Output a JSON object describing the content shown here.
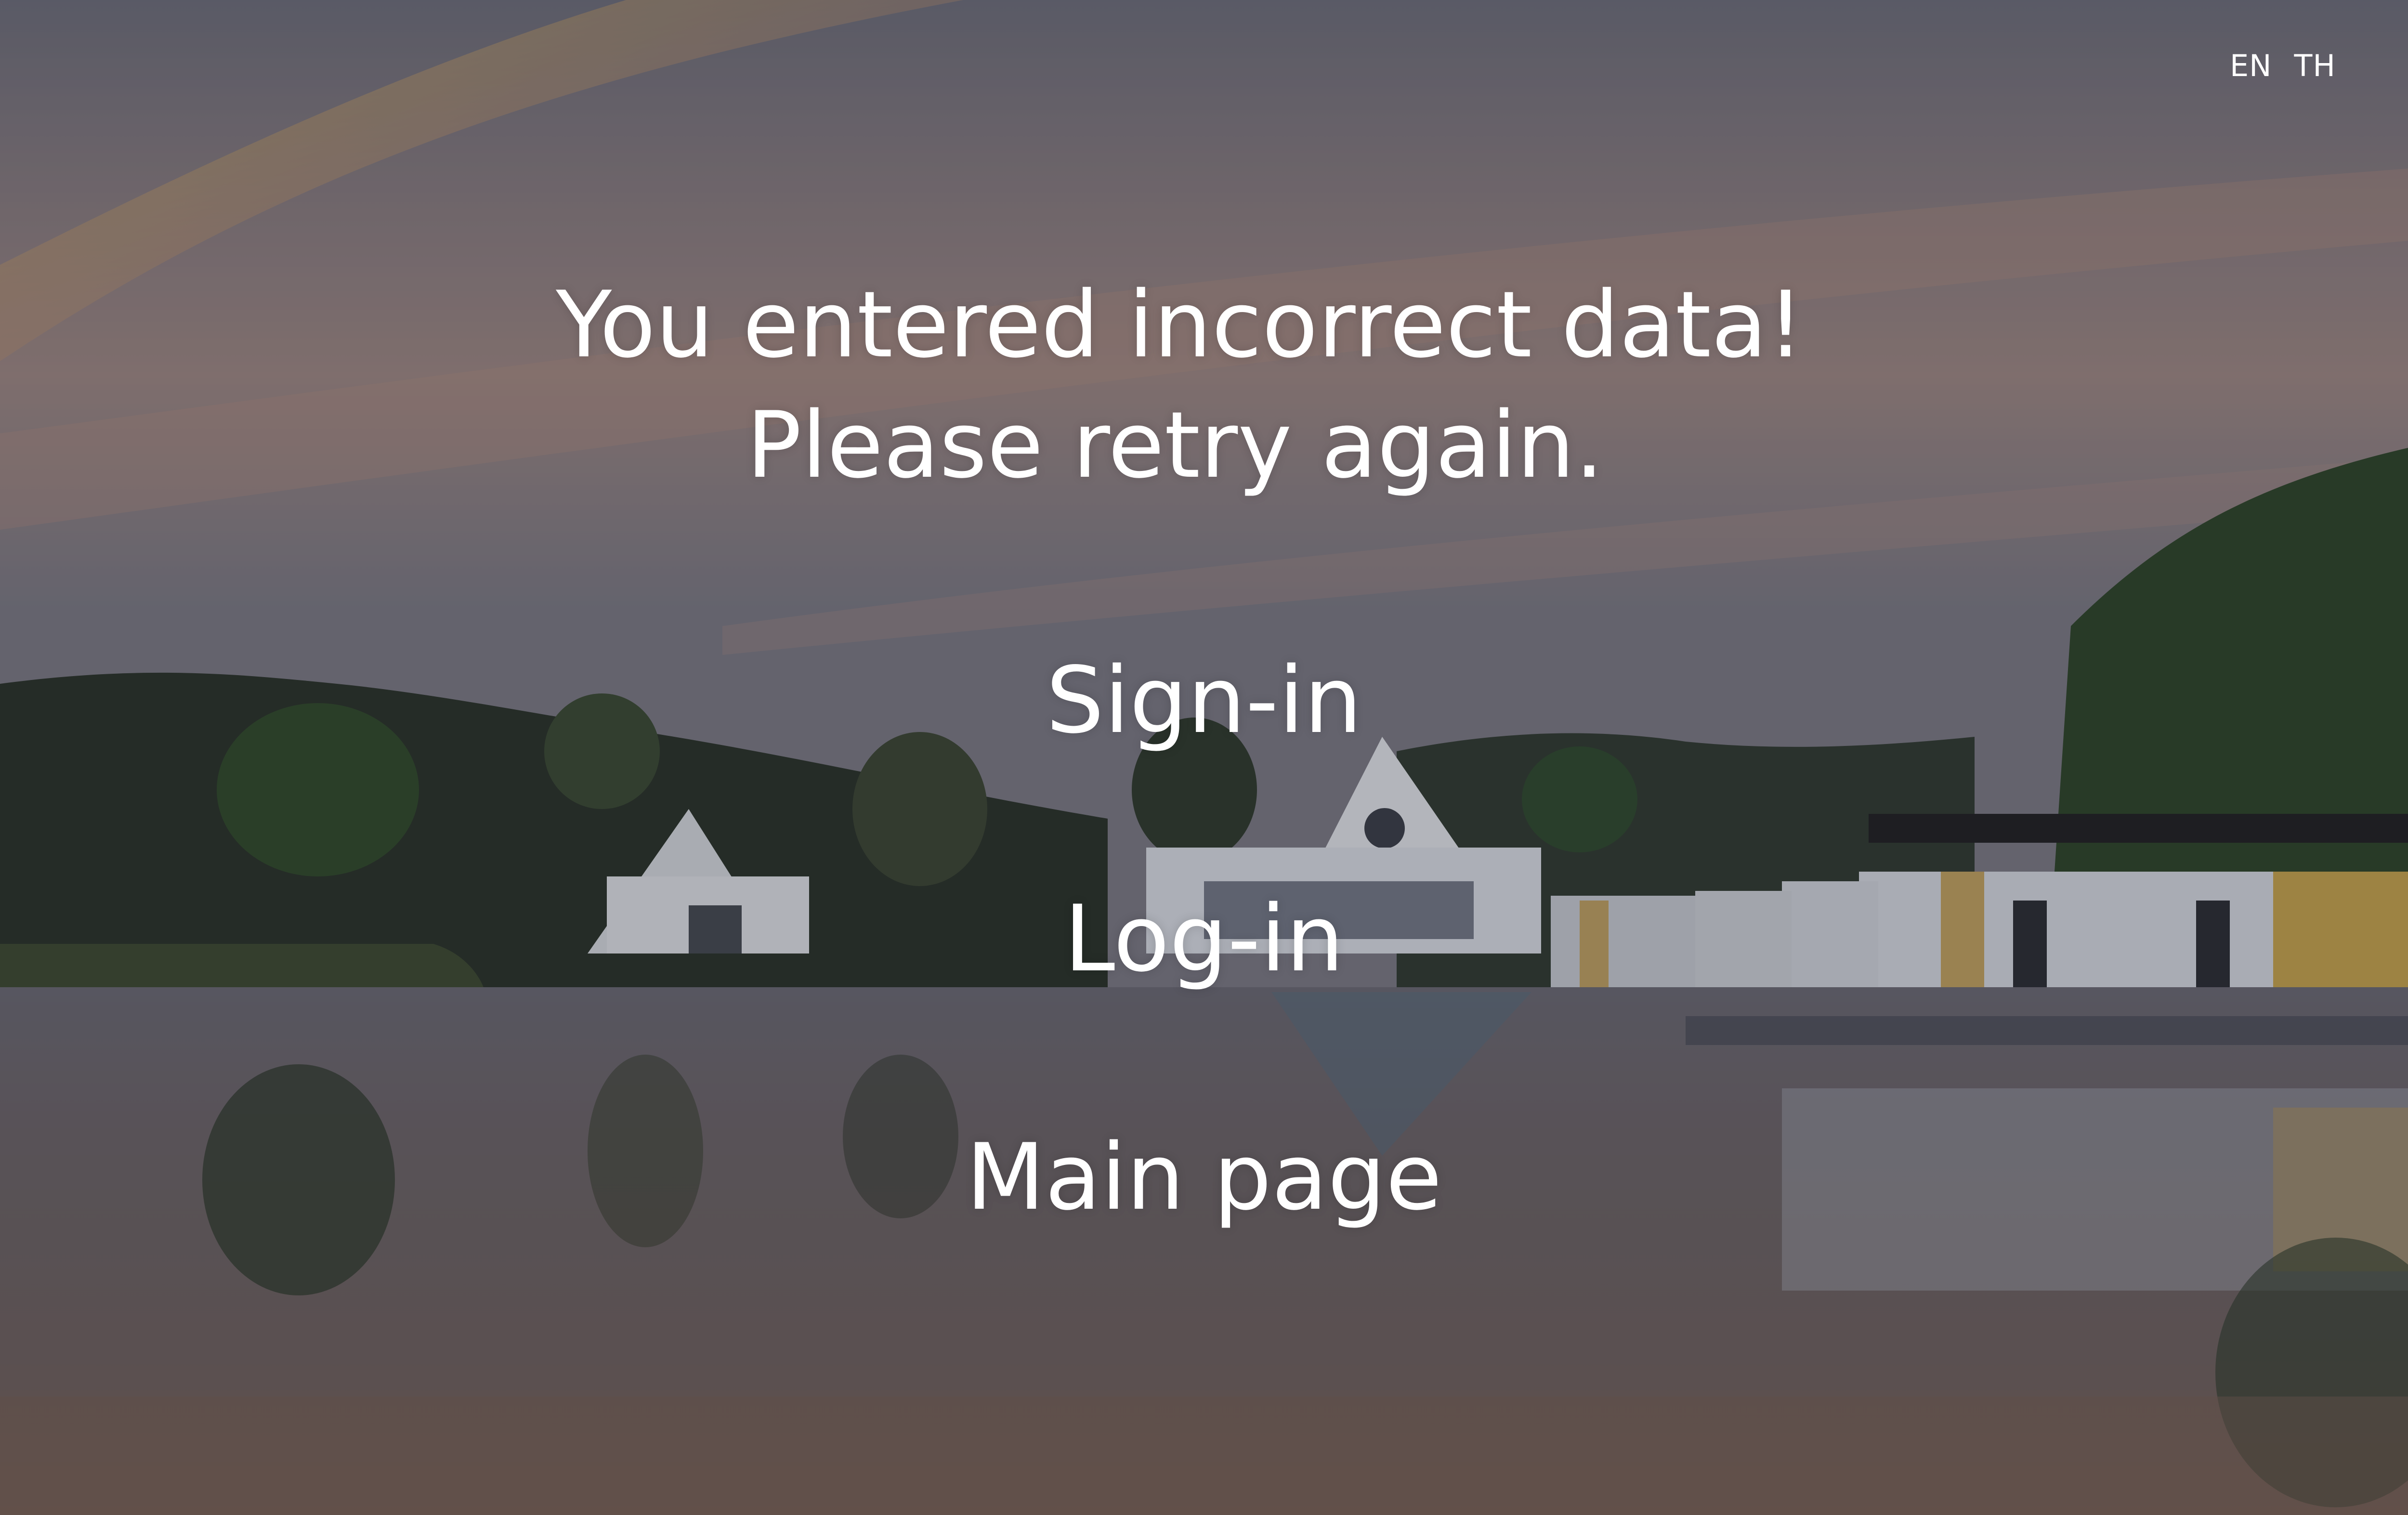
{
  "language_switch": {
    "items": [
      "EN",
      "TH"
    ]
  },
  "message": {
    "line1": "You entered incorrect data!",
    "line2": "Please retry again."
  },
  "nav": {
    "signin": "Sign-in",
    "login": "Log-in",
    "main_page": "Main page"
  },
  "background": {
    "scene": "lakeside-resort-at-dusk",
    "sky_top": "#6f6f7a",
    "sky_warm": "#a98a7c",
    "water": "#6a6362",
    "overlay": "rgba(30,30,35,0.35)"
  }
}
